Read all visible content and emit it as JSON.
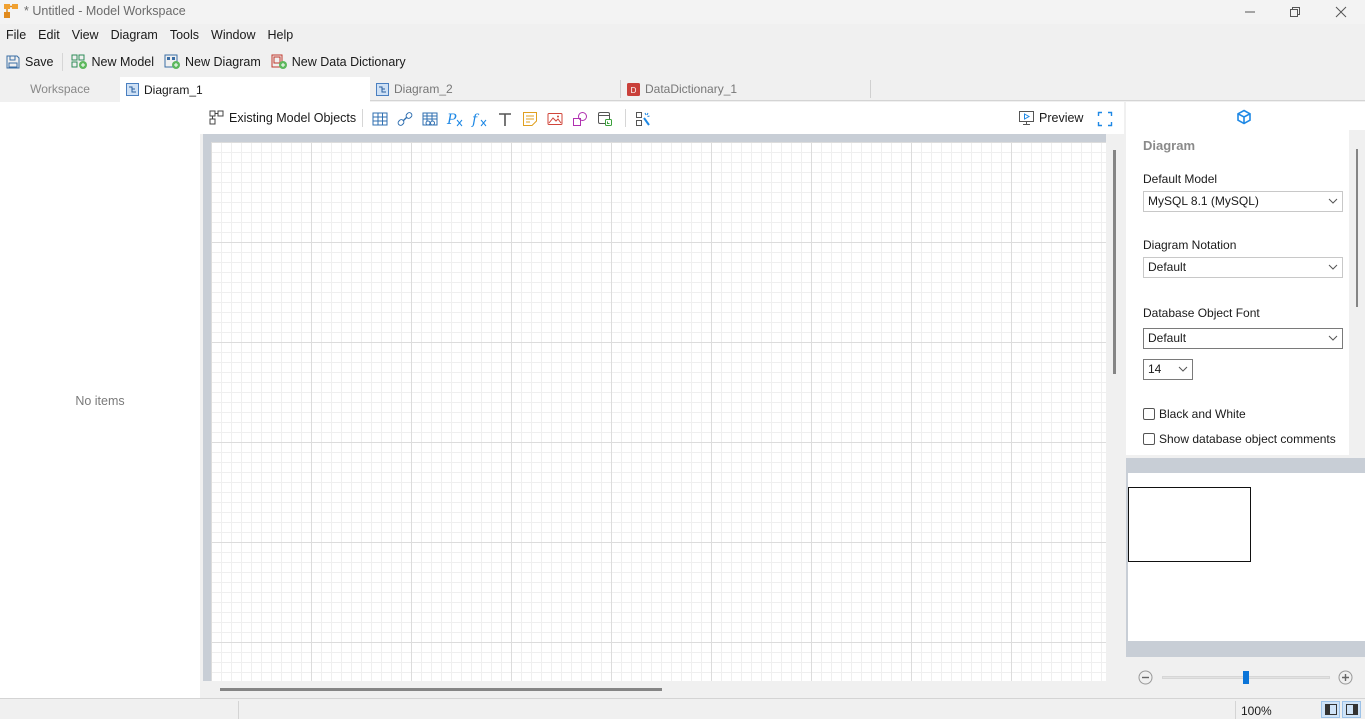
{
  "window": {
    "title": "* Untitled - Model Workspace",
    "controls": {
      "minimize": "minimize-icon",
      "maximize": "restore-icon",
      "close": "close-icon"
    }
  },
  "menu": [
    "File",
    "Edit",
    "View",
    "Diagram",
    "Tools",
    "Window",
    "Help"
  ],
  "toolbar": {
    "save": "Save",
    "new_model": "New Model",
    "new_diagram": "New Diagram",
    "new_data_dictionary": "New Data Dictionary"
  },
  "tabs": [
    {
      "label": "Workspace",
      "icon": "none",
      "active": false
    },
    {
      "label": "Diagram_1",
      "icon": "diagram-icon",
      "active": true
    },
    {
      "label": "Diagram_2",
      "icon": "diagram-icon",
      "active": false
    },
    {
      "label": "DataDictionary_1",
      "icon": "data-dictionary-icon",
      "active": false
    }
  ],
  "left_panel": {
    "empty_text": "No items"
  },
  "diagram_toolbar": {
    "existing_objects": "Existing Model Objects",
    "tools": [
      "table-icon",
      "relationship-icon",
      "view-icon",
      "procedure-icon",
      "function-icon",
      "text-icon",
      "note-icon",
      "image-icon",
      "shape-icon",
      "group-icon",
      "auto-layout-icon"
    ],
    "preview": "Preview",
    "fullscreen": "fullscreen-icon"
  },
  "properties": {
    "header_icon": "cube-icon",
    "section_title": "Diagram",
    "default_model_label": "Default Model",
    "default_model_value": "MySQL 8.1 (MySQL)",
    "notation_label": "Diagram Notation",
    "notation_value": "Default",
    "font_label": "Database Object Font",
    "font_value": "Default",
    "font_size_value": "14",
    "black_and_white_label": "Black and White",
    "black_and_white_checked": false,
    "show_comments_label": "Show database object comments",
    "show_comments_checked": false
  },
  "zoom": {
    "percent_label": "100%",
    "slider_fraction": 0.5
  },
  "colors": {
    "accent": "#0a74d8",
    "canvas_border": "#c8ced6"
  }
}
